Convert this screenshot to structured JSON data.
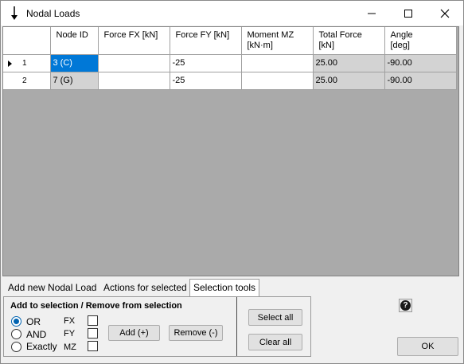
{
  "window": {
    "title": "Nodal Loads"
  },
  "grid": {
    "columns": [
      "",
      "Node ID",
      "Force FX [kN]",
      "Force FY [kN]",
      "Moment MZ\n[kN·m]",
      "Total Force\n[kN]",
      "Angle\n[deg]"
    ],
    "rows": [
      {
        "num": "1",
        "node": "3 (C)",
        "fx": "",
        "fy": "-25",
        "mz": "",
        "total": "25.00",
        "angle": "-90.00"
      },
      {
        "num": "2",
        "node": "7 (G)",
        "fx": "",
        "fy": "-25",
        "mz": "",
        "total": "25.00",
        "angle": "-90.00"
      }
    ]
  },
  "tabs": [
    "Add new Nodal Load",
    "Actions for selected",
    "Selection tools"
  ],
  "selection": {
    "group_title": "Add to selection / Remove from selection",
    "modes": [
      "OR",
      "AND",
      "Exactly"
    ],
    "selected_mode": "OR",
    "components": [
      "FX",
      "FY",
      "MZ"
    ],
    "add_label": "Add (+)",
    "remove_label": "Remove (-)",
    "select_all_label": "Select all",
    "clear_all_label": "Clear all"
  },
  "footer": {
    "ok_label": "OK",
    "help_icon": "question-icon"
  }
}
